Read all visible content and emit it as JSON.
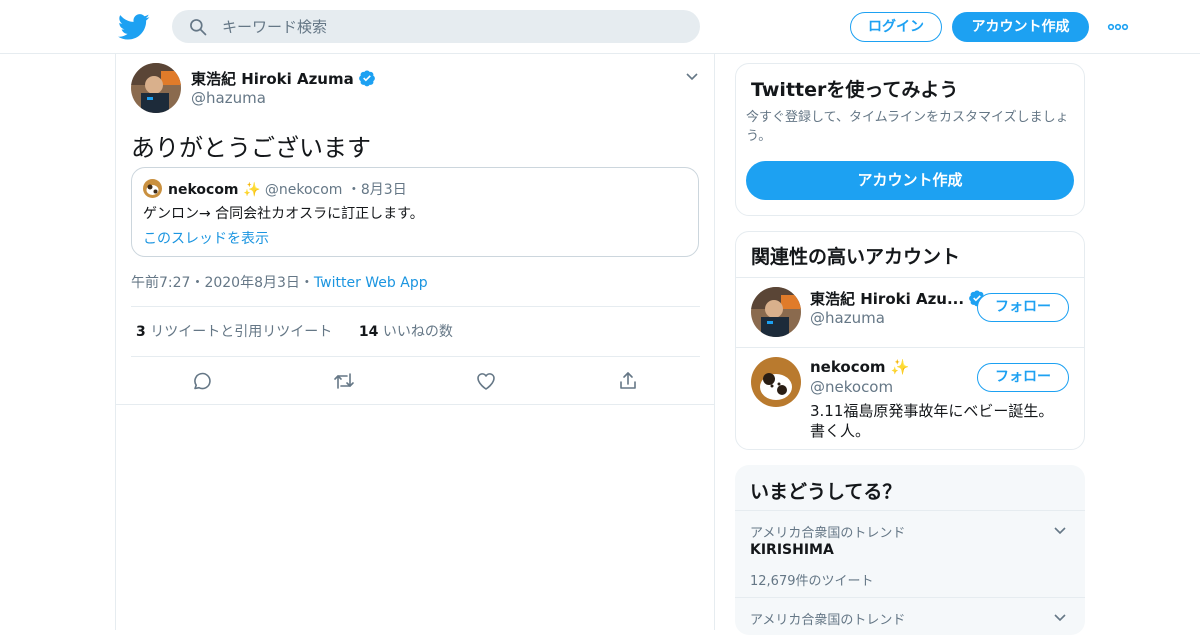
{
  "header": {
    "search_placeholder": "キーワード検索",
    "login_label": "ログイン",
    "signup_label": "アカウント作成",
    "logo_icon": "twitter-bird-icon",
    "brand_color": "#1da1f2"
  },
  "tweet": {
    "author_name": "東浩紀 Hiroki Azuma",
    "author_handle": "@hazuma",
    "text": "ありがとうございます",
    "quote": {
      "name": "nekocom",
      "emoji": "✨",
      "handle": "@nekocom",
      "dot": "・",
      "date": "8月3日",
      "text": "ゲンロン→ 合同会社カオスラに訂正します。",
      "thread_link": "このスレッドを表示"
    },
    "time": "午前7:27",
    "sep1": "・",
    "date": "2020年8月3日",
    "sep2": "・",
    "app": "Twitter Web App",
    "retweet_count": "3",
    "retweet_label": "リツイートと引用リツイート",
    "like_count": "14",
    "like_label": "いいねの数"
  },
  "sidebar": {
    "signup_card": {
      "title": "Twitterを使ってみよう",
      "subtitle": "今すぐ登録して、タイムラインをカスタマイズしましょう。",
      "button": "アカウント作成"
    },
    "related": {
      "title": "関連性の高いアカウント",
      "accounts": [
        {
          "name": "東浩紀 Hiroki Azu...",
          "handle": "@hazuma",
          "bio": "",
          "follow_label": "フォロー"
        },
        {
          "name": "nekocom ✨",
          "handle": "@nekocom",
          "bio": "3.11福島原発事故年にベビー誕生。 書く人。",
          "follow_label": "フォロー"
        }
      ]
    },
    "trends": {
      "title": "いまどうしてる？",
      "items": [
        {
          "context": "アメリカ合衆国のトレンド",
          "name": "KIRISHIMA",
          "count": "12,679件のツイート"
        },
        {
          "context": "アメリカ合衆国のトレンド",
          "name": "",
          "count": ""
        }
      ]
    }
  }
}
